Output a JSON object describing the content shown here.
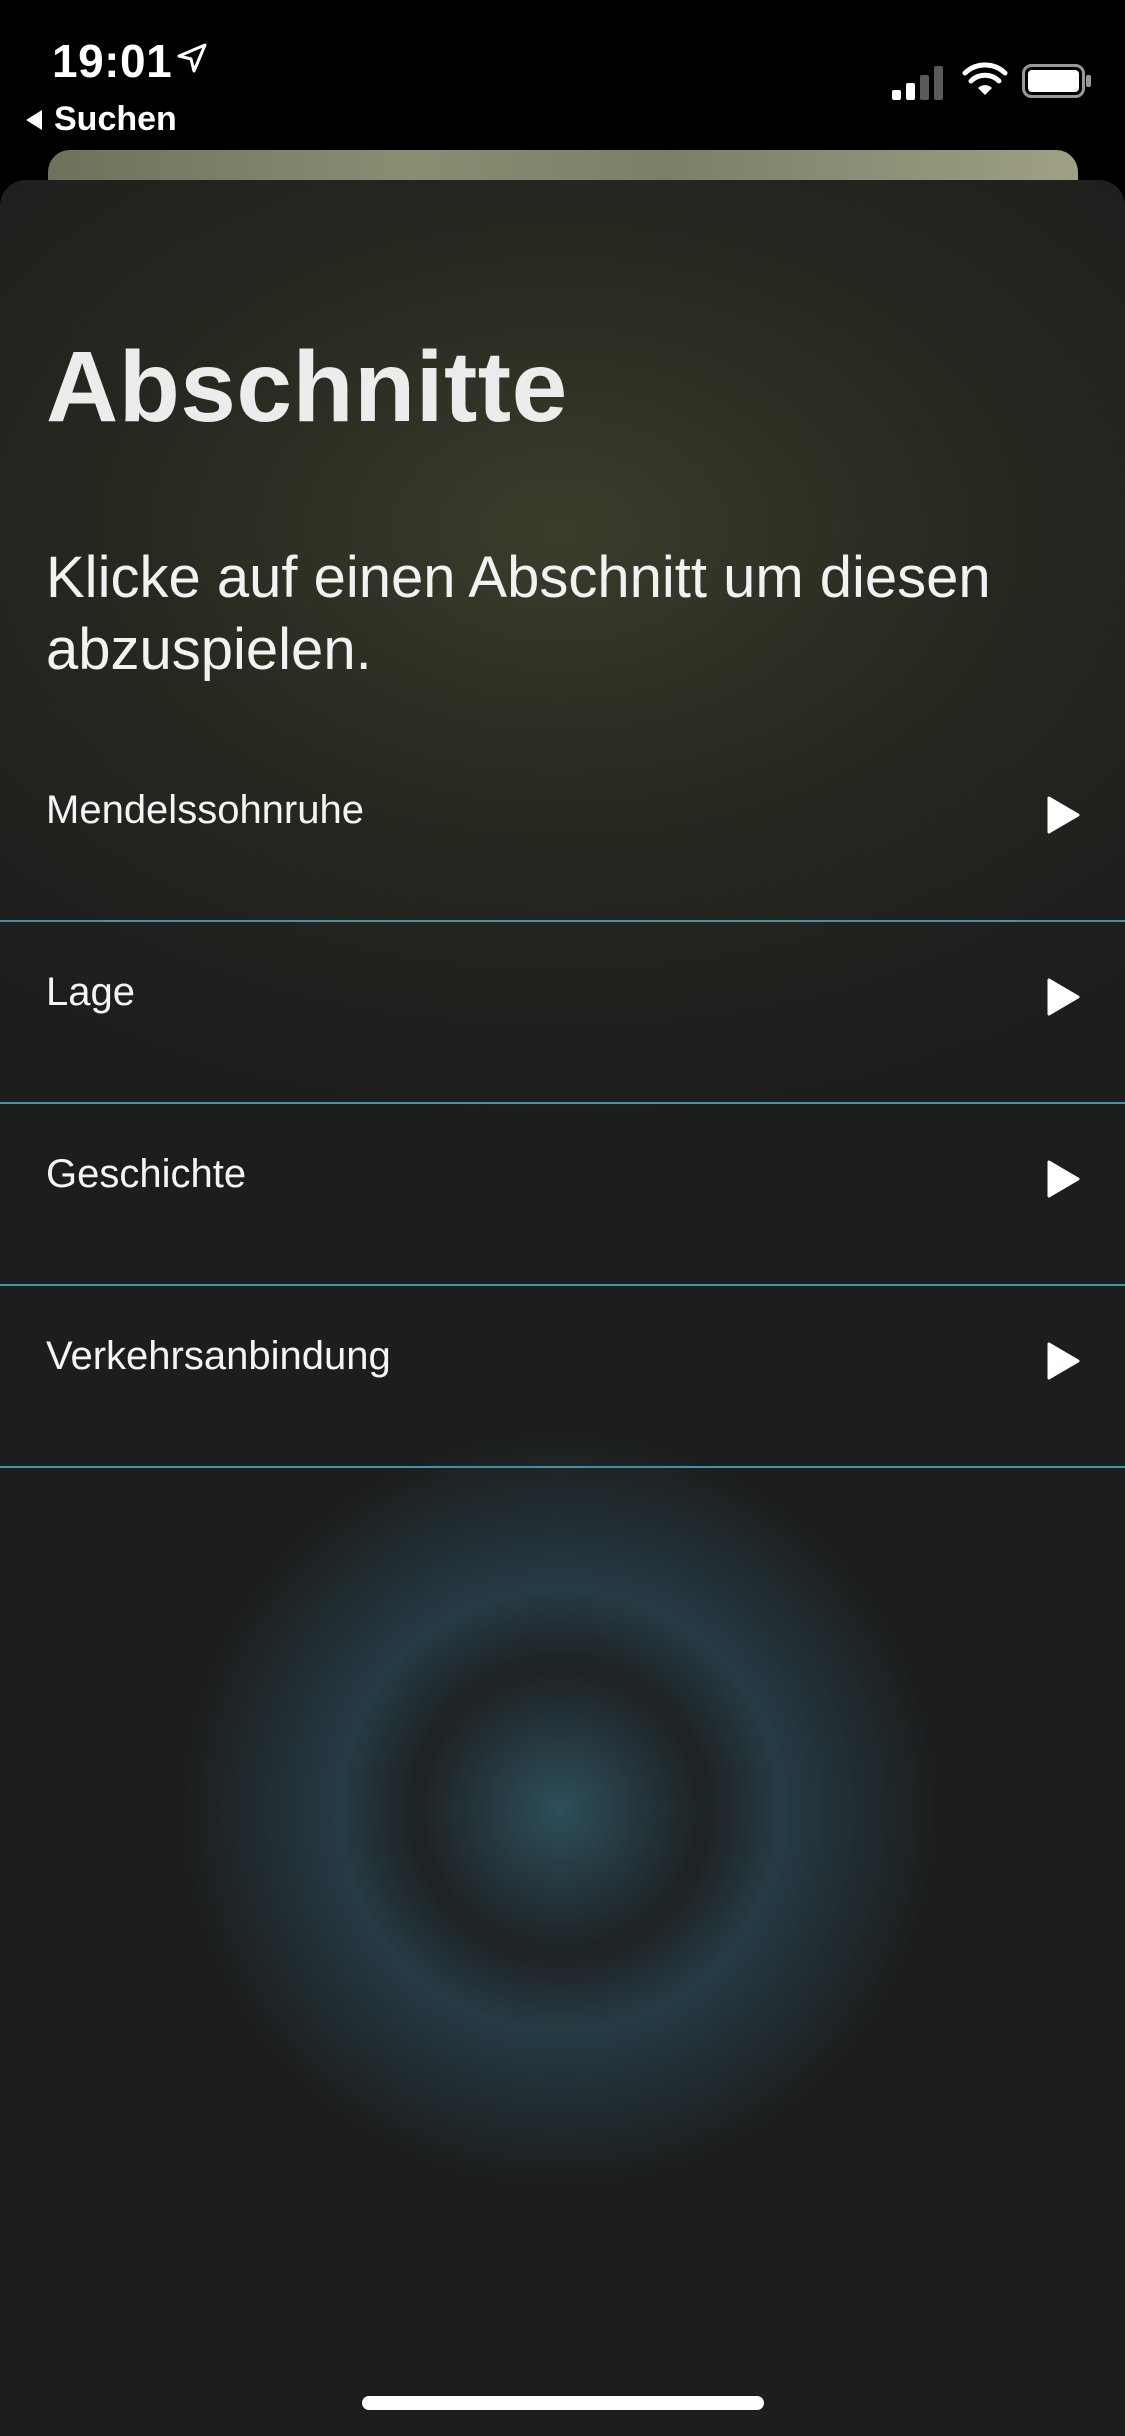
{
  "status_bar": {
    "time": "19:01",
    "back_label": "Suchen"
  },
  "sheet": {
    "title": "Abschnitte",
    "subtitle": "Klicke auf einen Abschnitt um diesen abzuspielen.",
    "sections": [
      {
        "label": "Mendelssohnruhe"
      },
      {
        "label": "Lage"
      },
      {
        "label": "Geschichte"
      },
      {
        "label": "Verkehrsanbindung"
      }
    ]
  },
  "icons": {
    "location": "location-arrow-icon",
    "signal": "cellular-signal-icon",
    "wifi": "wifi-icon",
    "battery": "battery-icon",
    "play": "play-icon",
    "back": "back-caret-icon"
  },
  "colors": {
    "divider": "#4a8fa8",
    "background": "#1c1d1d"
  }
}
